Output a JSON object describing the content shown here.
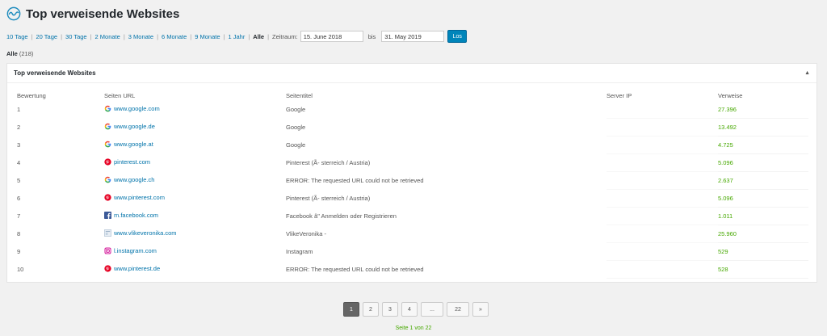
{
  "header": {
    "title": "Top verweisende Websites"
  },
  "filters": {
    "links": [
      "10 Tage",
      "20 Tage",
      "30 Tage",
      "2 Monate",
      "3 Monate",
      "6 Monate",
      "9 Monate",
      "1 Jahr"
    ],
    "active": "Alle",
    "range_label": "Zeitraum:",
    "from": "15. June 2018",
    "to_label": "bis",
    "to": "31. May 2019",
    "go_label": "Los"
  },
  "summary": {
    "label": "Alle",
    "count": "(218)"
  },
  "panel": {
    "title": "Top verweisende Websites",
    "toggle": "▲",
    "columns": [
      "Bewertung",
      "Seiten URL",
      "Seitentitel",
      "Server IP",
      "Verweise"
    ],
    "rows": [
      {
        "rank": "1",
        "icon": "google-icon",
        "url": "www.google.com",
        "title": "Google",
        "ip": "",
        "refs": "27.396"
      },
      {
        "rank": "2",
        "icon": "google-icon",
        "url": "www.google.de",
        "title": "Google",
        "ip": "",
        "refs": "13.492"
      },
      {
        "rank": "3",
        "icon": "google-icon",
        "url": "www.google.at",
        "title": "Google",
        "ip": "",
        "refs": "4.725"
      },
      {
        "rank": "4",
        "icon": "pinterest-icon",
        "url": "pinterest.com",
        "title": "Pinterest (Ã- sterreich / Austria)",
        "ip": "",
        "refs": "5.096"
      },
      {
        "rank": "5",
        "icon": "google-icon",
        "url": "www.google.ch",
        "title": "ERROR: The requested URL could not be retrieved",
        "ip": "",
        "refs": "2.637"
      },
      {
        "rank": "6",
        "icon": "pinterest-icon",
        "url": "www.pinterest.com",
        "title": "Pinterest (Ã- sterreich / Austria)",
        "ip": "",
        "refs": "5.096"
      },
      {
        "rank": "7",
        "icon": "facebook-icon",
        "url": "m.facebook.com",
        "title": "Facebook â\" Anmelden oder Registrieren",
        "ip": "",
        "refs": "1.011"
      },
      {
        "rank": "8",
        "icon": "generic-site-icon",
        "url": "www.vlikeveronika.com",
        "title": "VlikeVeronika -",
        "ip": "",
        "refs": "25.960"
      },
      {
        "rank": "9",
        "icon": "instagram-icon",
        "url": "l.instagram.com",
        "title": "Instagram",
        "ip": "",
        "refs": "529"
      },
      {
        "rank": "10",
        "icon": "pinterest-icon",
        "url": "www.pinterest.de",
        "title": "ERROR: The requested URL could not be retrieved",
        "ip": "",
        "refs": "528"
      }
    ]
  },
  "pager": {
    "pages": [
      "1",
      "2",
      "3",
      "4",
      "...",
      "22",
      "»"
    ],
    "current": "1",
    "info": "Seite 1 von 22"
  },
  "colors": {
    "link": "#0073aa",
    "count": "#46a800",
    "primary_button": "#0085ba",
    "current_page": "#666666"
  }
}
